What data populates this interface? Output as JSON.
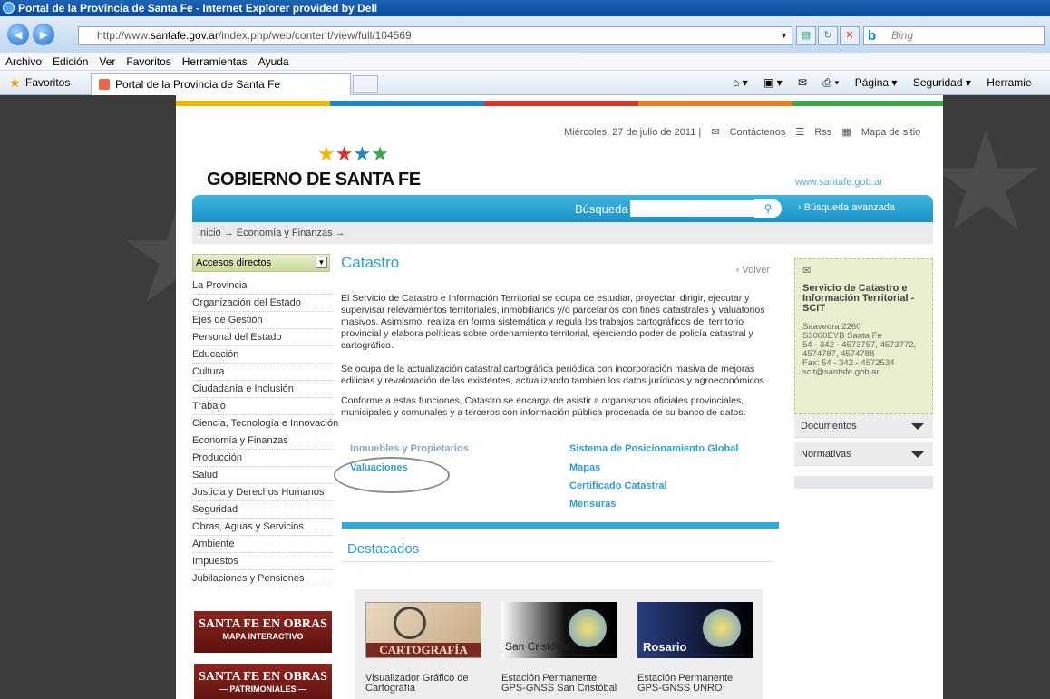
{
  "window": {
    "title": "Portal de la Provincia de Santa Fe - Internet Explorer provided by Dell"
  },
  "address_bar": {
    "url_prefix": "http://www.",
    "url_domain": "santafe.gov.ar",
    "url_path": "/index.php/web/content/view/full/104569",
    "search_placeholder": "Bing"
  },
  "menu": [
    "Archivo",
    "Edición",
    "Ver",
    "Favoritos",
    "Herramientas",
    "Ayuda"
  ],
  "favorites": {
    "label": "Favoritos",
    "tab_title": "Portal de la Provincia de Santa Fe",
    "commands": [
      "Página ▾",
      "Seguridad ▾",
      "Herramie"
    ]
  },
  "site": {
    "date": "Miércoles, 27 de julio de 2011",
    "contact": "Contáctenos",
    "rss": "Rss",
    "sitemap": "Mapa de sitio",
    "logo": "GOBIERNO DE SANTA FE",
    "www": "www.santafe.gob.ar",
    "search_label": "Búsqueda",
    "advanced_search": "Búsqueda avanzada",
    "breadcrumb": "Inicio → Economía y Finanzas →"
  },
  "sidebar": {
    "dropdown_label": "Accesos directos",
    "items": [
      "La Provincia",
      "Organización del Estado",
      "Ejes de Gestión",
      "Personal del Estado",
      "Educación",
      "Cultura",
      "Ciudadanía e Inclusión",
      "Trabajo",
      "Ciencia, Tecnología e Innovación",
      "Economía y Finanzas",
      "Producción",
      "Salud",
      "Justicia y Derechos Humanos",
      "Seguridad",
      "Obras, Aguas y Servicios",
      "Ambiente",
      "Impuestos",
      "Jubilaciones y Pensiones"
    ],
    "promo1": {
      "title": "SANTA FE EN OBRAS",
      "subtitle": "MAPA INTERACTIVO"
    },
    "promo2": {
      "title": "SANTA FE EN OBRAS",
      "subtitle": "— PATRIMONIALES —"
    }
  },
  "main": {
    "title": "Catastro",
    "back": "‹ Volver",
    "p1": "El Servicio de Catastro e Información Territorial se ocupa de estudiar, proyectar, dirigir, ejecutar y supervisar relevamientos territoriales, inmobiliarios y/o parcelarios con fines catastrales y valuatorios masivos. Asimismo, realiza en forma sistemática y regula los trabajos cartográficos del territorio provincial y elabora políticas sobre ordenamiento territorial, ejerciendo poder de policía catastral y cartográfico.",
    "p2": "Se ocupa de la actualización catastral cartográfica periódica con incorporación masiva de mejoras edilicias y revaloración de las existentes, actualizando también los datos jurídicos y agroeconómicos.",
    "p3": "Conforme a estas funciones, Catastro se encarga de asistir a organismos oficiales provinciales, municipales y comunales y a terceros con información pública procesada de su banco de datos.",
    "links_left": [
      "Inmuebles y Propietarios",
      "Valuaciones"
    ],
    "links_right": [
      "Sistema de Posicionamiento Global",
      "Mapas",
      "Certificado Catastral",
      "Mensuras"
    ],
    "featured_title": "Destacados",
    "cards": [
      {
        "img_text": "CARTOGRAFÍA",
        "caption": "Visualizador Gráfico de Cartografía"
      },
      {
        "img_text": "San Cristóbal",
        "caption": "Estación Permanente GPS-GNSS San Cristóbal"
      },
      {
        "img_text": "Rosario",
        "caption": "Estación Permanente GPS-GNSS UNRO"
      }
    ]
  },
  "right": {
    "title": "Servicio de Catastro e Información Territorial - SCIT",
    "address": "Saavedra 2260",
    "city": "S3000EYB Santa Fe",
    "phones": "54 - 342 - 4573757, 4573772, 4574787, 4574788",
    "fax": "Fax: 54 - 342 - 4572534",
    "email": "scit@santafe.gob.ar",
    "nav": [
      "Documentos",
      "Normativas"
    ]
  }
}
